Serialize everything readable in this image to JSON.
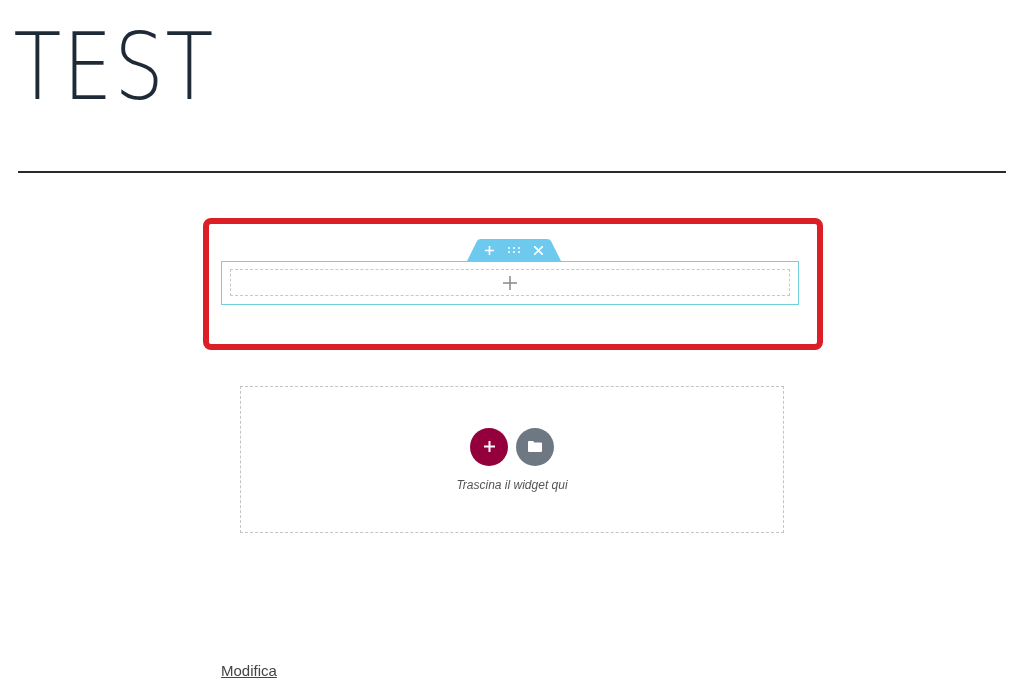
{
  "page_title": "TEST",
  "dropzone": {
    "hint": "Trascina il widget qui"
  },
  "edit_link": "Modifica"
}
